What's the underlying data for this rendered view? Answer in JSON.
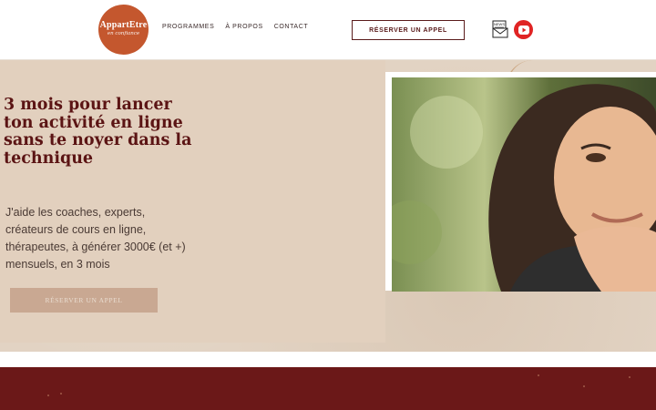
{
  "header": {
    "logo": {
      "main": "AppartEtre",
      "sub": "en confiance"
    },
    "nav": [
      "PROGRAMMES",
      "À PROPOS",
      "CONTACT"
    ],
    "cta": "RÉSERVER UN APPEL",
    "icons": [
      "news-envelope-icon",
      "youtube-icon"
    ],
    "news_icon_label": "NEWS"
  },
  "hero": {
    "headline": "3 mois pour lancer ton activité en ligne sans te noyer dans la technique",
    "subtext": "J'aide les coaches, experts, créateurs de cours en ligne, thérapeutes, à générer 3000€ (et +) mensuels, en 3 mois",
    "cta": "RÉSERVER UN APPEL"
  },
  "colors": {
    "brand": "#5b1414",
    "logo": "#c4572e",
    "hero_bg": "#e2d3c3",
    "band": "#6b1818",
    "youtube": "#e02424"
  }
}
